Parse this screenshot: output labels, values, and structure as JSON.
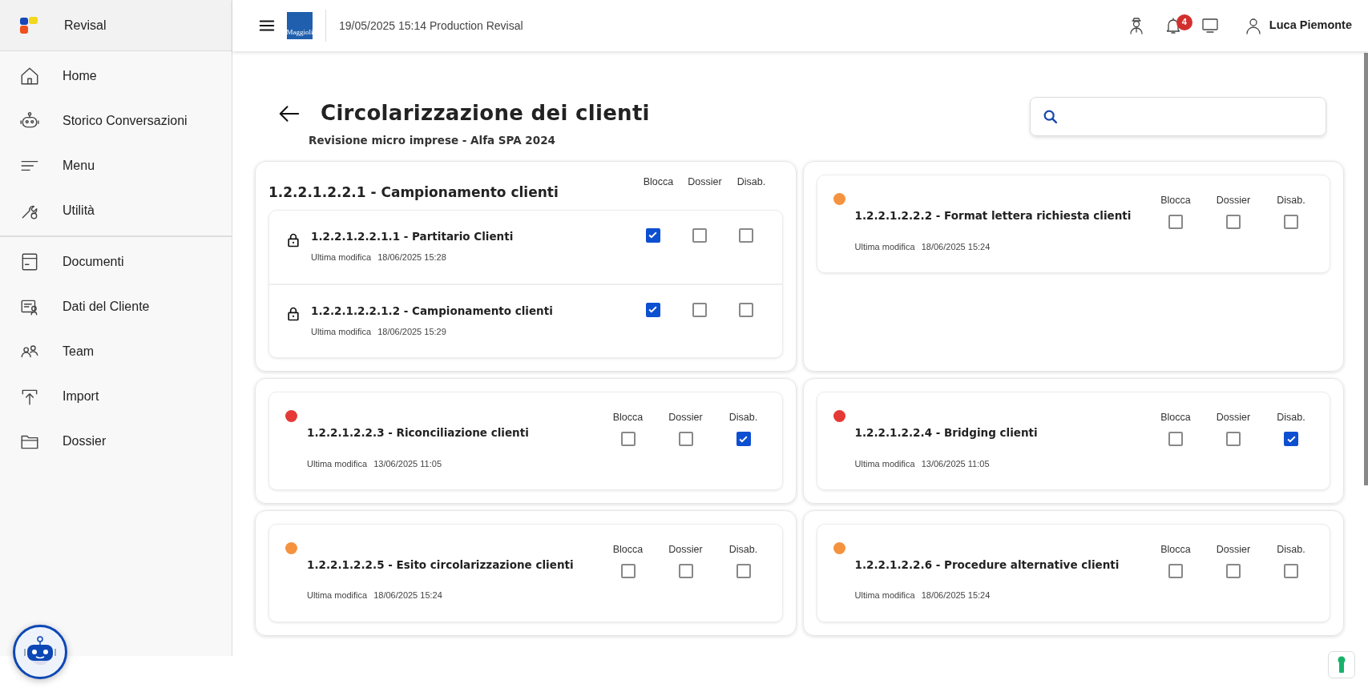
{
  "sidebar": {
    "brand": "Revisal",
    "groups": [
      [
        {
          "label": "Home"
        },
        {
          "label": "Storico Conversazioni"
        },
        {
          "label": "Menu"
        },
        {
          "label": "Utilità"
        }
      ],
      [
        {
          "label": "Documenti"
        },
        {
          "label": "Dati del Cliente"
        },
        {
          "label": "Team"
        },
        {
          "label": "Import"
        },
        {
          "label": "Dossier"
        }
      ]
    ]
  },
  "header": {
    "logo_text": "Maggioli",
    "info": "19/05/2025 15:14 Production Revisal",
    "notifications": "4",
    "user": "Luca Piemonte"
  },
  "page": {
    "title": "Circolarizzazione dei clienti",
    "subtitle": "Revisione micro imprese - Alfa SPA 2024"
  },
  "cards": [
    {
      "kind": "group",
      "title": "1.2.2.1.2.2.1 - Campionamento clienti",
      "columns": [
        "Blocca",
        "Dossier",
        "Disab."
      ],
      "children": [
        {
          "locked": true,
          "title": "1.2.2.1.2.2.1.1 - Partitario Clienti",
          "modified_label": "Ultima modifica",
          "modified_at": "18/06/2025 15:28",
          "checks": [
            {
              "checked": true
            },
            {
              "checked": false
            },
            {
              "checked": false
            }
          ]
        },
        {
          "locked": true,
          "title": "1.2.2.1.2.2.1.2 - Campionamento clienti",
          "modified_label": "Ultima modifica",
          "modified_at": "18/06/2025 15:29",
          "checks": [
            {
              "checked": true
            },
            {
              "checked": false
            },
            {
              "checked": false
            }
          ]
        }
      ]
    },
    {
      "kind": "item",
      "color": "#f5923e",
      "title": "1.2.2.1.2.2.2 - Format lettera richiesta clienti",
      "modified_label": "Ultima modifica",
      "modified_at": "18/06/2025 15:24",
      "checks": [
        {
          "label": "Blocca",
          "checked": false
        },
        {
          "label": "Dossier",
          "checked": false
        },
        {
          "label": "Disab.",
          "checked": false
        }
      ]
    },
    {
      "kind": "item",
      "color": "#e53935",
      "title": "1.2.2.1.2.2.3 - Riconciliazione clienti",
      "modified_label": "Ultima modifica",
      "modified_at": "13/06/2025 11:05",
      "checks": [
        {
          "label": "Blocca",
          "checked": false
        },
        {
          "label": "Dossier",
          "checked": false
        },
        {
          "label": "Disab.",
          "checked": true
        }
      ]
    },
    {
      "kind": "item",
      "color": "#e53935",
      "title": "1.2.2.1.2.2.4 - Bridging clienti",
      "modified_label": "Ultima modifica",
      "modified_at": "13/06/2025 11:05",
      "checks": [
        {
          "label": "Blocca",
          "checked": false
        },
        {
          "label": "Dossier",
          "checked": false
        },
        {
          "label": "Disab.",
          "checked": true
        }
      ]
    },
    {
      "kind": "item",
      "color": "#f5923e",
      "title": "1.2.2.1.2.2.5 - Esito circolarizzazione clienti",
      "modified_label": "Ultima modifica",
      "modified_at": "18/06/2025 15:24",
      "checks": [
        {
          "label": "Blocca",
          "checked": false
        },
        {
          "label": "Dossier",
          "checked": false
        },
        {
          "label": "Disab.",
          "checked": false
        }
      ]
    },
    {
      "kind": "item",
      "color": "#f5923e",
      "title": "1.2.2.1.2.2.6 - Procedure alternative clienti",
      "modified_label": "Ultima modifica",
      "modified_at": "18/06/2025 15:24",
      "checks": [
        {
          "label": "Blocca",
          "checked": false
        },
        {
          "label": "Dossier",
          "checked": false
        },
        {
          "label": "Disab.",
          "checked": false
        }
      ]
    }
  ]
}
